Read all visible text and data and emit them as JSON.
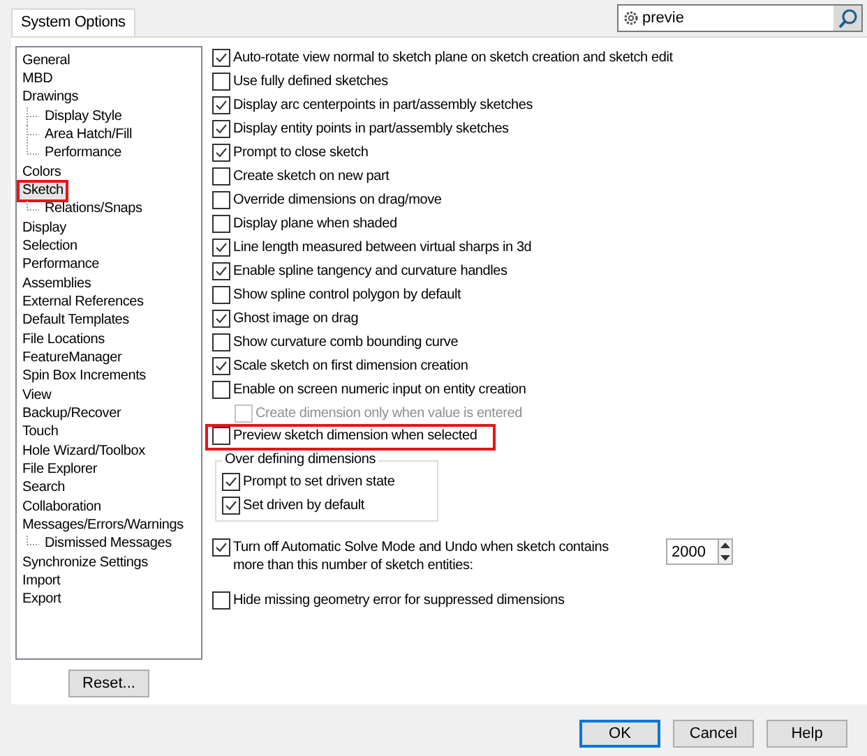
{
  "tab": {
    "label": "System Options",
    "selected": true
  },
  "search": {
    "value": "previe"
  },
  "tree": [
    {
      "label": "General",
      "selected": false,
      "highlighted": false
    },
    {
      "label": "MBD",
      "selected": false,
      "highlighted": false
    },
    {
      "label": "Drawings",
      "selected": false,
      "highlighted": false,
      "children": [
        {
          "label": "Display Style",
          "selected": false,
          "highlighted": false
        },
        {
          "label": "Area Hatch/Fill",
          "selected": false,
          "highlighted": false
        },
        {
          "label": "Performance",
          "selected": false,
          "highlighted": false
        }
      ]
    },
    {
      "label": "Colors",
      "selected": false,
      "highlighted": false
    },
    {
      "label": "Sketch",
      "selected": true,
      "highlighted": true,
      "children": [
        {
          "label": "Relations/Snaps",
          "selected": false,
          "highlighted": false
        }
      ]
    },
    {
      "label": "Display",
      "selected": false,
      "highlighted": false
    },
    {
      "label": "Selection",
      "selected": false,
      "highlighted": false
    },
    {
      "label": "Performance",
      "selected": false,
      "highlighted": false
    },
    {
      "label": "Assemblies",
      "selected": false,
      "highlighted": false
    },
    {
      "label": "External References",
      "selected": false,
      "highlighted": false
    },
    {
      "label": "Default Templates",
      "selected": false,
      "highlighted": false
    },
    {
      "label": "File Locations",
      "selected": false,
      "highlighted": false
    },
    {
      "label": "FeatureManager",
      "selected": false,
      "highlighted": false
    },
    {
      "label": "Spin Box Increments",
      "selected": false,
      "highlighted": false
    },
    {
      "label": "View",
      "selected": false,
      "highlighted": false
    },
    {
      "label": "Backup/Recover",
      "selected": false,
      "highlighted": false
    },
    {
      "label": "Touch",
      "selected": false,
      "highlighted": false
    },
    {
      "label": "Hole Wizard/Toolbox",
      "selected": false,
      "highlighted": false
    },
    {
      "label": "File Explorer",
      "selected": false,
      "highlighted": false
    },
    {
      "label": "Search",
      "selected": false,
      "highlighted": false
    },
    {
      "label": "Collaboration",
      "selected": false,
      "highlighted": false
    },
    {
      "label": "Messages/Errors/Warnings",
      "selected": false,
      "highlighted": false,
      "children": [
        {
          "label": "Dismissed Messages",
          "selected": false,
          "highlighted": false
        }
      ]
    },
    {
      "label": "Synchronize Settings",
      "selected": false,
      "highlighted": false
    },
    {
      "label": "Import",
      "selected": false,
      "highlighted": false
    },
    {
      "label": "Export",
      "selected": false,
      "highlighted": false
    }
  ],
  "reset_button": "Reset...",
  "options": [
    {
      "kind": "checkbox",
      "label": "Auto-rotate view normal to sketch plane on sketch creation and sketch edit",
      "checked": true,
      "disabled": false
    },
    {
      "kind": "checkbox",
      "label": "Use fully defined sketches",
      "checked": false,
      "disabled": false
    },
    {
      "kind": "checkbox",
      "label": "Display arc centerpoints in part/assembly sketches",
      "checked": true,
      "disabled": false
    },
    {
      "kind": "checkbox",
      "label": "Display entity points in part/assembly sketches",
      "checked": true,
      "disabled": false
    },
    {
      "kind": "checkbox",
      "label": "Prompt to close sketch",
      "checked": true,
      "disabled": false
    },
    {
      "kind": "checkbox",
      "label": "Create sketch on new part",
      "checked": false,
      "disabled": false
    },
    {
      "kind": "checkbox",
      "label": "Override dimensions on drag/move",
      "checked": false,
      "disabled": false
    },
    {
      "kind": "checkbox",
      "label": "Display plane when shaded",
      "checked": false,
      "disabled": false
    },
    {
      "kind": "checkbox",
      "label": "Line length measured between virtual sharps in 3d",
      "checked": true,
      "disabled": false
    },
    {
      "kind": "checkbox",
      "label": "Enable spline tangency and curvature handles",
      "checked": true,
      "disabled": false
    },
    {
      "kind": "checkbox",
      "label": "Show spline control polygon by default",
      "checked": false,
      "disabled": false
    },
    {
      "kind": "checkbox",
      "label": "Ghost image on drag",
      "checked": true,
      "disabled": false
    },
    {
      "kind": "checkbox",
      "label": "Show curvature comb bounding curve",
      "checked": false,
      "disabled": false
    },
    {
      "kind": "checkbox",
      "label": "Scale sketch on first dimension creation",
      "checked": true,
      "disabled": false
    },
    {
      "kind": "checkbox",
      "label": "Enable on screen numeric input on entity creation",
      "checked": false,
      "disabled": false,
      "children": [
        {
          "kind": "checkbox",
          "label": "Create dimension only when value is entered",
          "checked": false,
          "disabled": true
        }
      ]
    },
    {
      "kind": "checkbox",
      "label": "Preview sketch dimension when selected",
      "checked": false,
      "disabled": false,
      "highlighted": true
    },
    {
      "kind": "group",
      "label": "Over defining dimensions",
      "children": [
        {
          "kind": "checkbox",
          "label": "Prompt to set driven state",
          "checked": true,
          "disabled": false
        },
        {
          "kind": "checkbox",
          "label": "Set driven by default",
          "checked": true,
          "disabled": false
        }
      ]
    },
    {
      "kind": "spin",
      "label": "Turn off Automatic Solve Mode and Undo when sketch contains more than this number of sketch entities:",
      "checked": true,
      "disabled": false,
      "value": "2000"
    },
    {
      "kind": "checkbox",
      "label": "Hide missing geometry error for suppressed dimensions",
      "checked": false,
      "disabled": false
    }
  ],
  "buttons": [
    {
      "label": "OK",
      "default": true
    },
    {
      "label": "Cancel",
      "default": false
    },
    {
      "label": "Help",
      "default": false
    }
  ]
}
